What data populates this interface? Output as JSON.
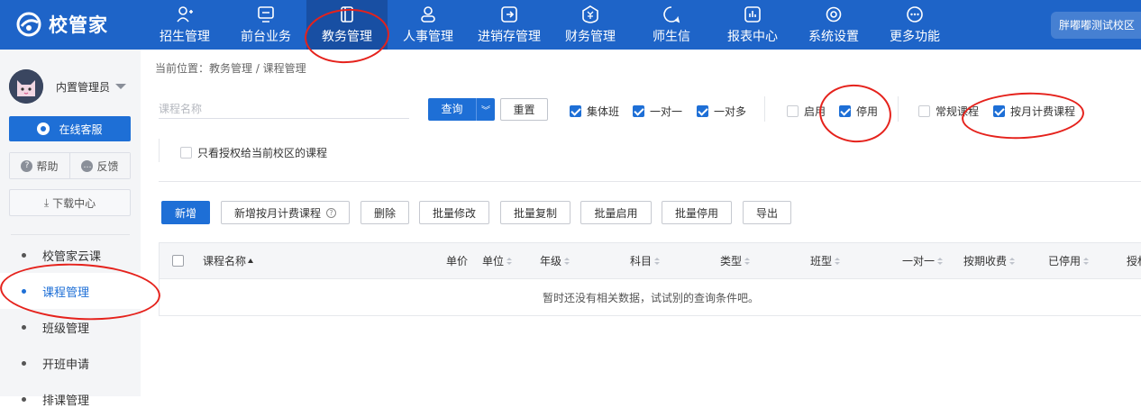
{
  "app": {
    "logo_text": "校管家",
    "campus": "胖嘟嘟测试校区"
  },
  "nav": [
    {
      "label": "招生管理",
      "icon": "person-add-icon"
    },
    {
      "label": "前台业务",
      "icon": "monitor-icon"
    },
    {
      "label": "教务管理",
      "icon": "book-icon",
      "active": true
    },
    {
      "label": "人事管理",
      "icon": "person-icon"
    },
    {
      "label": "进销存管理",
      "icon": "exchange-icon"
    },
    {
      "label": "财务管理",
      "icon": "money-icon"
    },
    {
      "label": "师生信",
      "icon": "chat-icon"
    },
    {
      "label": "报表中心",
      "icon": "bar-chart-icon"
    },
    {
      "label": "系统设置",
      "icon": "gear-icon"
    },
    {
      "label": "更多功能",
      "icon": "more-icon"
    }
  ],
  "sidebar": {
    "user_name": "内置管理员",
    "service_label": "在线客服",
    "help_label": "帮助",
    "feedback_label": "反馈",
    "download_label": "下载中心",
    "menu": [
      {
        "label": "校管家云课"
      },
      {
        "label": "课程管理",
        "active": true
      },
      {
        "label": "班级管理"
      },
      {
        "label": "开班申请"
      },
      {
        "label": "排课管理"
      }
    ]
  },
  "breadcrumb": "当前位置：教务管理 / 课程管理",
  "filters": {
    "search_placeholder": "课程名称",
    "query_label": "查询",
    "reset_label": "重置",
    "checkboxes": [
      {
        "label": "集体班",
        "checked": true
      },
      {
        "label": "一对一",
        "checked": true
      },
      {
        "label": "一对多",
        "checked": true
      },
      {
        "label": "启用",
        "checked": false
      },
      {
        "label": "停用",
        "checked": true
      },
      {
        "label": "常规课程",
        "checked": false
      },
      {
        "label": "按月计费课程",
        "checked": true
      }
    ],
    "auth_only_label": "只看授权给当前校区的课程",
    "auth_only_checked": false
  },
  "toolbar": {
    "add": "新增",
    "add_monthly": "新增按月计费课程",
    "delete": "删除",
    "batch_edit": "批量修改",
    "batch_copy": "批量复制",
    "batch_enable": "批量启用",
    "batch_disable": "批量停用",
    "export": "导出"
  },
  "table": {
    "columns": [
      "课程名称",
      "单价",
      "单位",
      "年级",
      "科目",
      "类型",
      "班型",
      "一对一",
      "按期收费",
      "已停用",
      "授权"
    ],
    "empty_text": "暂时还没有相关数据，试试别的查询条件吧。"
  },
  "colors": {
    "topbar": "#1e64c8",
    "primary": "#1e6fd6",
    "annotation": "#e5221c"
  }
}
